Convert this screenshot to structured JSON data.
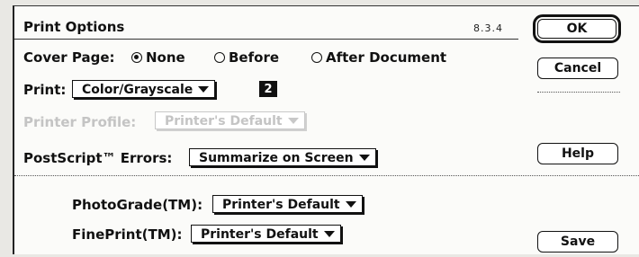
{
  "dialog": {
    "title": "Print Options",
    "version": "8.3.4"
  },
  "cover_page": {
    "label": "Cover Page:",
    "options": [
      "None",
      "Before",
      "After Document"
    ],
    "selected": "None"
  },
  "print": {
    "label": "Print:",
    "value": "Color/Grayscale",
    "badge": "2"
  },
  "printer_profile": {
    "label": "Printer Profile:",
    "value": "Printer's Default",
    "enabled": false
  },
  "postscript_errors": {
    "label": "PostScript™ Errors:",
    "value": "Summarize on Screen"
  },
  "photograde": {
    "label": "PhotoGrade(TM):",
    "value": "Printer's Default"
  },
  "fineprint": {
    "label": "FinePrint(TM):",
    "value": "Printer's Default"
  },
  "buttons": {
    "ok": "OK",
    "cancel": "Cancel",
    "help": "Help",
    "save": "Save"
  }
}
